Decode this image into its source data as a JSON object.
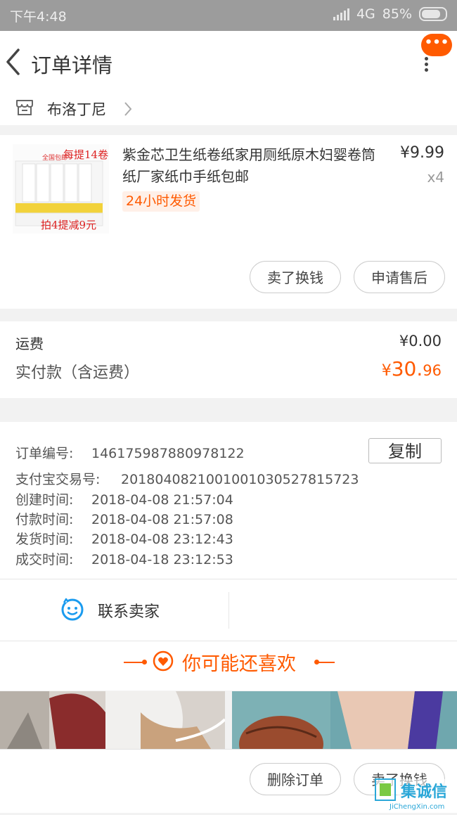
{
  "status_bar": {
    "time": "下午4:48",
    "network": "4G",
    "battery": "85%"
  },
  "header": {
    "title": "订单详情",
    "back_icon": "chevron-left-icon",
    "more_icon": "more-vertical-icon",
    "badge_text": "•••"
  },
  "shop": {
    "name": "布洛丁尼",
    "icon": "store-icon"
  },
  "product": {
    "title": "紫金芯卫生纸卷纸家用厕纸原木妇婴卷筒纸厂家纸巾手纸包邮",
    "price": "¥9.99",
    "quantity": "x4",
    "tag": "24小时发货",
    "thumb_text_top": "每提14卷",
    "thumb_text_small": "全国包邮",
    "thumb_text_bottom": "拍4提减9元",
    "actions": [
      "卖了换钱",
      "申请售后"
    ]
  },
  "fees": {
    "shipping_label": "运费",
    "shipping_value": "¥0.00",
    "total_label": "实付款（含运费）",
    "total_symbol": "¥",
    "total_int": "30.",
    "total_dec": "96"
  },
  "order_info": {
    "order_no_label": "订单编号:",
    "order_no": "146175987880978122",
    "copy_label": "复制",
    "alipay_label": "支付宝交易号:",
    "alipay_no": "2018040821001001030527815723",
    "created_label": "创建时间:",
    "created": "2018-04-08 21:57:04",
    "paid_label": "付款时间:",
    "paid": "2018-04-08 21:57:08",
    "shipped_label": "发货时间:",
    "shipped": "2018-04-08 23:12:43",
    "closed_label": "成交时间:",
    "closed": "2018-04-18 23:12:53"
  },
  "contact": {
    "label": "联系卖家",
    "icon": "chat-face-icon"
  },
  "recommend": {
    "title": "你可能还喜欢",
    "icon": "heart-icon"
  },
  "bottom_bar": {
    "delete_label": "删除订单",
    "sell_label": "卖了换钱"
  },
  "watermark": {
    "text": "JiChengXin.com",
    "brand": "集诚信"
  },
  "colors": {
    "accent": "#ff5a00",
    "tag_bg": "#fff0e8",
    "status_bar": "#9c9c9c"
  }
}
